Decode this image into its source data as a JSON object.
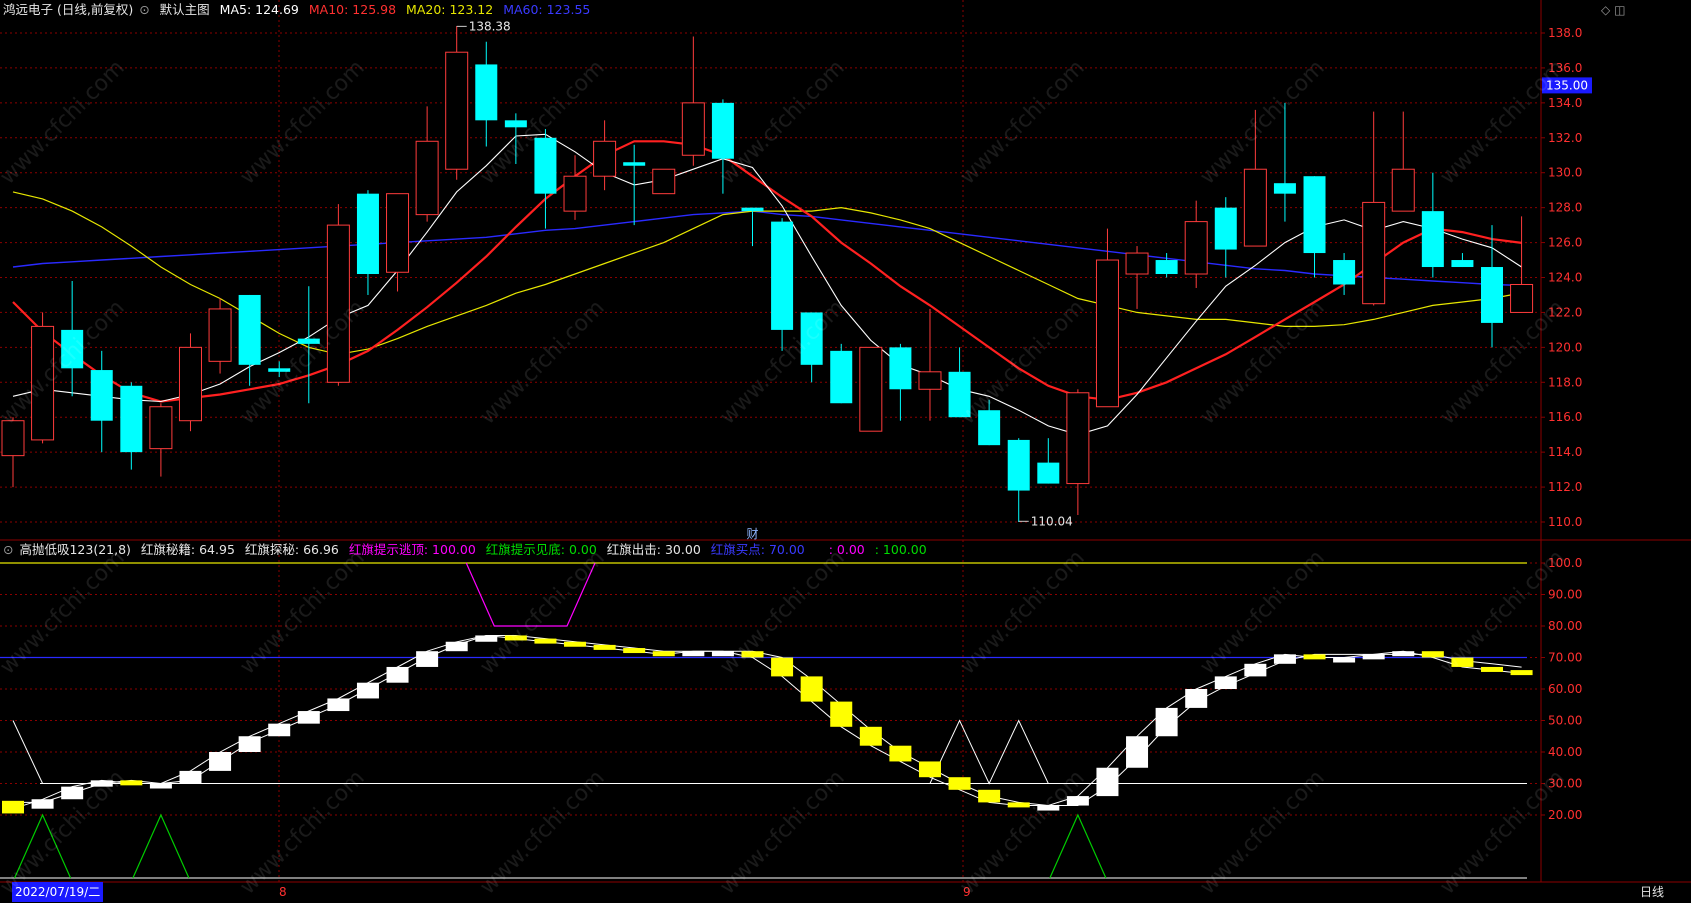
{
  "header": {
    "stock_name": "鸿远电子 (日线,前复权)",
    "main_chart_label": "默认主图",
    "ma5": "MA5: 124.69",
    "ma10": "MA10: 125.98",
    "ma20": "MA20: 123.12",
    "ma60": "MA60: 123.55"
  },
  "indicator_header": {
    "name": "高抛低吸123(21,8)",
    "v1": "红旗秘籍: 64.95",
    "v2": "红旗探秘: 66.96",
    "v3": "红旗提示逃顶: 100.00",
    "v4": "红旗提示见底: 0.00",
    "v5": "红旗出击: 30.00",
    "v6": "红旗买点: 70.00",
    "v7": ": 0.00",
    "v8": ": 100.00"
  },
  "annotations": {
    "high": "138.38",
    "low": "110.04",
    "fin_marker": "财",
    "current_price": "135.00"
  },
  "bottom": {
    "date": "2022/07/19/二",
    "month8": "8",
    "month9": "9",
    "period": "日线"
  },
  "watermark": "www.cfchi.com",
  "price_axis": {
    "ticks": [
      "138.0",
      "136.0",
      "134.0",
      "132.0",
      "130.0",
      "128.0",
      "126.0",
      "124.0",
      "122.0",
      "120.0",
      "118.0",
      "116.0",
      "114.0",
      "112.0",
      "110.0"
    ]
  },
  "ind_axis": {
    "ticks": [
      "100.0",
      "90.00",
      "80.00",
      "70.00",
      "60.00",
      "50.00",
      "40.00",
      "30.00",
      "20.00"
    ]
  },
  "colors": {
    "up": "#ff3c3c",
    "down": "#00ffff",
    "ma5": "#ffffff",
    "ma10": "#ff2020",
    "ma20": "#e6e600",
    "ma60": "#2a2aff",
    "grid": "#8b0000",
    "magenta": "#ff00ff",
    "green": "#00cc00"
  },
  "candles": [
    {
      "o": 113.8,
      "h": 116.0,
      "l": 112.0,
      "c": 115.8
    },
    {
      "o": 114.7,
      "h": 122.0,
      "l": 114.5,
      "c": 121.2
    },
    {
      "o": 121.0,
      "h": 123.8,
      "l": 117.2,
      "c": 118.8
    },
    {
      "o": 118.7,
      "h": 119.8,
      "l": 114.0,
      "c": 115.8
    },
    {
      "o": 117.8,
      "h": 118.0,
      "l": 113.0,
      "c": 114.0
    },
    {
      "o": 114.2,
      "h": 116.8,
      "l": 112.6,
      "c": 116.6
    },
    {
      "o": 115.8,
      "h": 120.8,
      "l": 115.2,
      "c": 120.0
    },
    {
      "o": 119.2,
      "h": 122.8,
      "l": 118.5,
      "c": 122.2
    },
    {
      "o": 123.0,
      "h": 123.0,
      "l": 117.8,
      "c": 119.0
    },
    {
      "o": 118.8,
      "h": 119.2,
      "l": 118.3,
      "c": 118.6
    },
    {
      "o": 120.5,
      "h": 123.5,
      "l": 116.8,
      "c": 120.2
    },
    {
      "o": 118.0,
      "h": 128.2,
      "l": 117.8,
      "c": 127.0
    },
    {
      "o": 128.8,
      "h": 129.0,
      "l": 123.0,
      "c": 124.2
    },
    {
      "o": 124.3,
      "h": 128.8,
      "l": 123.2,
      "c": 128.8
    },
    {
      "o": 127.6,
      "h": 133.8,
      "l": 127.2,
      "c": 131.8
    },
    {
      "o": 130.2,
      "h": 138.4,
      "l": 129.6,
      "c": 136.9
    },
    {
      "o": 136.2,
      "h": 137.5,
      "l": 131.5,
      "c": 133.0
    },
    {
      "o": 133.0,
      "h": 133.4,
      "l": 130.5,
      "c": 132.6
    },
    {
      "o": 132.0,
      "h": 132.5,
      "l": 126.8,
      "c": 128.8
    },
    {
      "o": 127.8,
      "h": 131.0,
      "l": 127.3,
      "c": 129.8
    },
    {
      "o": 129.8,
      "h": 133.0,
      "l": 129.0,
      "c": 131.8
    },
    {
      "o": 130.6,
      "h": 131.6,
      "l": 127.0,
      "c": 130.4
    },
    {
      "o": 128.8,
      "h": 130.2,
      "l": 128.8,
      "c": 130.2
    },
    {
      "o": 131.0,
      "h": 137.8,
      "l": 130.4,
      "c": 134.0
    },
    {
      "o": 134.0,
      "h": 134.2,
      "l": 128.8,
      "c": 130.8
    },
    {
      "o": 128.0,
      "h": 128.0,
      "l": 125.8,
      "c": 127.8
    },
    {
      "o": 127.2,
      "h": 127.4,
      "l": 119.8,
      "c": 121.0
    },
    {
      "o": 122.0,
      "h": 122.0,
      "l": 118.0,
      "c": 119.0
    },
    {
      "o": 119.8,
      "h": 120.2,
      "l": 116.8,
      "c": 116.8
    },
    {
      "o": 115.2,
      "h": 120.0,
      "l": 115.2,
      "c": 120.0
    },
    {
      "o": 120.0,
      "h": 120.2,
      "l": 115.8,
      "c": 117.6
    },
    {
      "o": 117.6,
      "h": 122.2,
      "l": 115.8,
      "c": 118.6
    },
    {
      "o": 118.6,
      "h": 120.0,
      "l": 116.0,
      "c": 116.0
    },
    {
      "o": 116.4,
      "h": 117.0,
      "l": 114.4,
      "c": 114.4
    },
    {
      "o": 114.7,
      "h": 114.8,
      "l": 110.0,
      "c": 111.8
    },
    {
      "o": 113.4,
      "h": 114.8,
      "l": 112.2,
      "c": 112.2
    },
    {
      "o": 112.2,
      "h": 117.6,
      "l": 110.4,
      "c": 117.4
    },
    {
      "o": 116.6,
      "h": 126.8,
      "l": 116.6,
      "c": 125.0
    },
    {
      "o": 124.2,
      "h": 125.8,
      "l": 122.2,
      "c": 125.4
    },
    {
      "o": 125.0,
      "h": 125.4,
      "l": 124.0,
      "c": 124.2
    },
    {
      "o": 124.2,
      "h": 128.4,
      "l": 123.4,
      "c": 127.2
    },
    {
      "o": 128.0,
      "h": 128.6,
      "l": 124.0,
      "c": 125.6
    },
    {
      "o": 125.8,
      "h": 133.6,
      "l": 125.8,
      "c": 130.2
    },
    {
      "o": 129.4,
      "h": 134.0,
      "l": 127.2,
      "c": 128.8
    },
    {
      "o": 129.8,
      "h": 129.8,
      "l": 124.0,
      "c": 125.4
    },
    {
      "o": 125.0,
      "h": 125.4,
      "l": 123.0,
      "c": 123.6
    },
    {
      "o": 122.5,
      "h": 133.5,
      "l": 122.4,
      "c": 128.3
    },
    {
      "o": 127.8,
      "h": 133.5,
      "l": 127.8,
      "c": 130.2
    },
    {
      "o": 127.8,
      "h": 130.0,
      "l": 124.0,
      "c": 124.6
    },
    {
      "o": 125.0,
      "h": 125.4,
      "l": 124.6,
      "c": 124.6
    },
    {
      "o": 124.6,
      "h": 127.0,
      "l": 120.0,
      "c": 121.4
    },
    {
      "o": 122.0,
      "h": 127.5,
      "l": 122.0,
      "c": 123.6
    }
  ],
  "ma5": [
    117.2,
    117.6,
    117.4,
    117.2,
    117.0,
    116.9,
    117.3,
    117.9,
    118.9,
    119.7,
    120.6,
    121.7,
    122.4,
    124.4,
    126.6,
    128.9,
    130.4,
    132.1,
    132.2,
    131.2,
    130.0,
    129.3,
    129.6,
    130.2,
    130.8,
    130.3,
    128.1,
    125.2,
    122.4,
    120.4,
    119.0,
    118.4,
    117.6,
    117.2,
    116.4,
    115.5,
    115.0,
    115.5,
    117.3,
    119.4,
    121.5,
    123.5,
    124.7,
    126.0,
    126.9,
    127.3,
    126.7,
    127.2,
    126.8,
    126.2,
    125.7,
    124.6
  ],
  "ma10": [
    122.6,
    120.9,
    119.6,
    118.4,
    117.4,
    116.9,
    117.1,
    117.3,
    117.6,
    117.9,
    118.4,
    119.0,
    119.8,
    121.0,
    122.3,
    123.7,
    125.2,
    126.9,
    128.5,
    129.8,
    131.0,
    131.8,
    131.8,
    131.6,
    131.0,
    129.8,
    128.6,
    127.5,
    126.0,
    124.8,
    123.5,
    122.4,
    121.2,
    120.0,
    118.8,
    117.8,
    117.2,
    117.0,
    117.4,
    118.0,
    118.8,
    119.6,
    120.6,
    121.6,
    122.6,
    123.6,
    124.8,
    126.0,
    126.8,
    126.6,
    126.2,
    125.98
  ],
  "ma20": [
    128.9,
    128.5,
    127.8,
    126.9,
    125.8,
    124.6,
    123.6,
    122.8,
    121.8,
    120.8,
    120.0,
    119.6,
    119.9,
    120.5,
    121.2,
    121.8,
    122.4,
    123.1,
    123.6,
    124.2,
    124.8,
    125.4,
    126.0,
    126.8,
    127.6,
    127.8,
    127.8,
    127.8,
    128.0,
    127.7,
    127.3,
    126.8,
    126.0,
    125.2,
    124.4,
    123.6,
    122.8,
    122.4,
    122.0,
    121.8,
    121.6,
    121.6,
    121.4,
    121.2,
    121.2,
    121.3,
    121.6,
    122.0,
    122.4,
    122.6,
    122.8,
    123.12
  ],
  "ma60": [
    124.6,
    124.8,
    124.9,
    125.0,
    125.1,
    125.2,
    125.3,
    125.4,
    125.5,
    125.6,
    125.7,
    125.8,
    125.9,
    126.0,
    126.1,
    126.2,
    126.3,
    126.5,
    126.7,
    126.8,
    127.0,
    127.2,
    127.4,
    127.6,
    127.7,
    127.8,
    127.6,
    127.5,
    127.3,
    127.1,
    126.9,
    126.7,
    126.5,
    126.3,
    126.1,
    125.9,
    125.7,
    125.5,
    125.3,
    125.1,
    124.9,
    124.7,
    124.5,
    124.4,
    124.2,
    124.1,
    124.0,
    123.9,
    123.8,
    123.7,
    123.6,
    123.55
  ],
  "ind_a": [
    22,
    25,
    29,
    31,
    30,
    30,
    34,
    40,
    45,
    49,
    53,
    57,
    62,
    67,
    72,
    75,
    77,
    76,
    75,
    74,
    73,
    72,
    71,
    72,
    72,
    70,
    64,
    56,
    48,
    42,
    37,
    32,
    28,
    24,
    23,
    23,
    26,
    35,
    45,
    54,
    60,
    64,
    68,
    71,
    70,
    70,
    71,
    72,
    70,
    67,
    66,
    64.95
  ],
  "ind_b": [
    24,
    24,
    27,
    30,
    31,
    30,
    31,
    37,
    43,
    47,
    51,
    55,
    60,
    65,
    70,
    74,
    77,
    77,
    76,
    75,
    74,
    73,
    72,
    72,
    72,
    72,
    70,
    63,
    55,
    47,
    40,
    35,
    30,
    26,
    24,
    23,
    23,
    29,
    38,
    48,
    56,
    61,
    65,
    69,
    71,
    71,
    71,
    71,
    71,
    69,
    68,
    66.96
  ],
  "green_peaks": [
    {
      "i": 1
    },
    {
      "i": 5
    },
    {
      "i": 36
    }
  ]
}
